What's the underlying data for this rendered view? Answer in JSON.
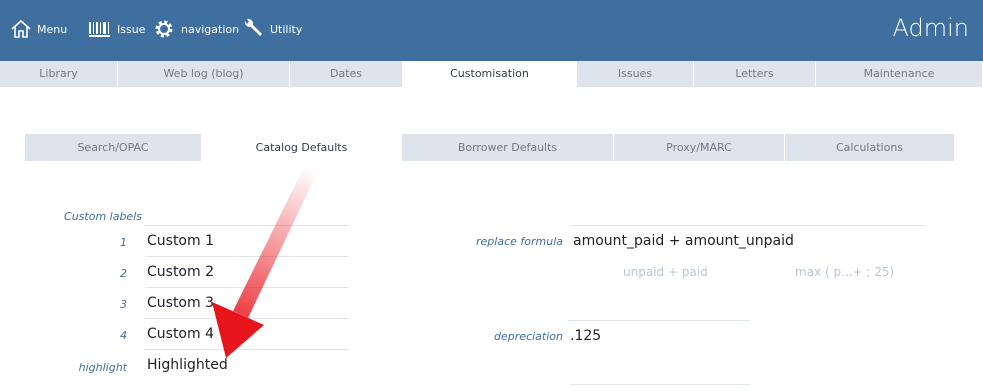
{
  "topbar": {
    "menu_label": "Menu",
    "issue_label": "Issue",
    "navigation_label": "navigation",
    "utility_label": "Utility",
    "admin_title": "Admin"
  },
  "tabs": [
    {
      "label": "Library"
    },
    {
      "label": "Web log (blog)"
    },
    {
      "label": "Dates"
    },
    {
      "label": "Customisation"
    },
    {
      "label": "Issues"
    },
    {
      "label": "Letters"
    },
    {
      "label": "Maintenance"
    }
  ],
  "active_tab": "Customisation",
  "subtabs": [
    {
      "label": "Search/OPAC"
    },
    {
      "label": "Catalog Defaults"
    },
    {
      "label": "Borrower Defaults"
    },
    {
      "label": "Proxy/MARC"
    },
    {
      "label": "Calculations"
    }
  ],
  "active_subtab": "Catalog Defaults",
  "custom_labels": {
    "heading": "Custom labels",
    "rows": [
      {
        "num": "1",
        "value": "Custom 1"
      },
      {
        "num": "2",
        "value": "Custom 2"
      },
      {
        "num": "3",
        "value": "Custom 3"
      },
      {
        "num": "4",
        "value": "Custom 4"
      }
    ],
    "highlight_label": "highlight",
    "highlight_value": "Highlighted"
  },
  "formula": {
    "replace_label": "replace formula",
    "replace_value": "amount_paid + amount_unpaid",
    "hint1": "unpaid + paid",
    "hint2": "max ( p...+ ; 25)",
    "depreciation_label": "depreciation",
    "depreciation_value": ".125"
  },
  "colors": {
    "header_bg": "#3f6f9f",
    "tab_bg": "#dde4ec",
    "label_color": "#3f6f9f",
    "arrow_color": "#e8141b"
  }
}
